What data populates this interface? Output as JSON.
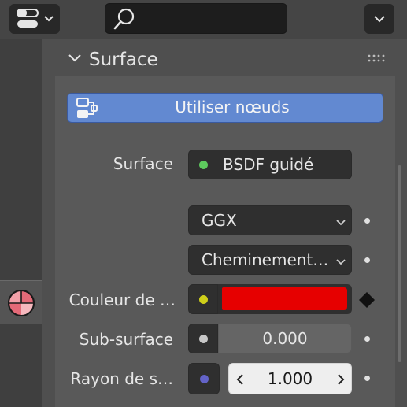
{
  "header": {
    "editor_type_icon": "properties-editor-icon",
    "search": {
      "placeholder": "",
      "icon": "search-icon"
    },
    "menu_icon": "chevron-down-icon"
  },
  "sidebar": {
    "active_tab_icon": "material-icon"
  },
  "panel": {
    "title": "Surface",
    "use_nodes_label": "Utiliser nœuds"
  },
  "properties": {
    "surface": {
      "label": "Surface",
      "value": "BSDF guidé",
      "dot_color": "#5ecb5e"
    },
    "distribution": {
      "value": "GGX"
    },
    "subsurface_method": {
      "value": "Cheminement…"
    },
    "base_color": {
      "label": "Couleur de …",
      "color": "#e60000",
      "dot_color": "#cfcf1a"
    },
    "subsurface": {
      "label": "Sub-surface",
      "value": "0.000",
      "dot_color": "#c8c8c8"
    },
    "subsurface_radius": {
      "label": "Rayon de s…",
      "value": "1.000",
      "dot_color": "#6363c8"
    }
  },
  "colors": {
    "accent_button": "#6289d1",
    "header_bg": "#454545",
    "panel_bg": "#595959"
  }
}
